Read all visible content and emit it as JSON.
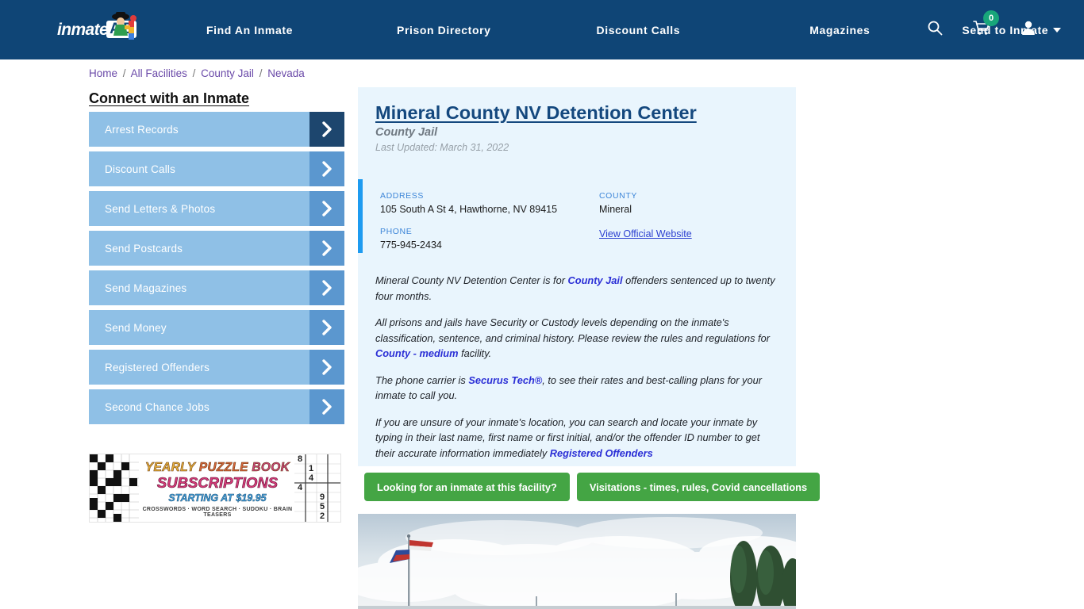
{
  "header": {
    "logo": {
      "text": "inmate",
      "badge": "AID",
      "icon": "inmateaid-logo-icon"
    },
    "nav": [
      {
        "label": "Find An Inmate",
        "has_caret": false
      },
      {
        "label": "Prison Directory",
        "has_caret": false
      },
      {
        "label": "Discount Calls",
        "has_caret": false
      },
      {
        "label": "Magazines",
        "has_caret": false
      },
      {
        "label": "Send to Inmate",
        "has_caret": true
      }
    ],
    "icons": {
      "search": "search-icon",
      "cart": "shopping-cart-icon",
      "cart_count": "0",
      "account": "user-account-icon"
    },
    "background_color": "#0f4576"
  },
  "breadcrumb": {
    "items": [
      "Home",
      "All Facilities",
      "County Jail",
      "Nevada"
    ],
    "separator": "/",
    "link_color": "#6a49a8"
  },
  "sidebar": {
    "title": "Connect with an Inmate",
    "items": [
      {
        "label": "Arrest Records",
        "active": true
      },
      {
        "label": "Discount Calls",
        "active": false
      },
      {
        "label": "Send Letters & Photos",
        "active": false
      },
      {
        "label": "Send Postcards",
        "active": false
      },
      {
        "label": "Send Magazines",
        "active": false
      },
      {
        "label": "Send Money",
        "active": false
      },
      {
        "label": "Registered Offenders",
        "active": false
      },
      {
        "label": "Second Chance Jobs",
        "active": false
      }
    ]
  },
  "ad": {
    "line1_word1": "YEARLY",
    "line1_word2": "PUZZLE",
    "line1_word3": "BOOK",
    "line2": "SUBSCRIPTIONS",
    "line3": "STARTING AT $19.95",
    "line4": "CROSSWORDS · WORD SEARCH · SUDOKU · BRAIN TEASERS",
    "sudoku_digits": [
      "8",
      "1",
      "4",
      "4",
      "9",
      "5",
      "2"
    ]
  },
  "facility": {
    "name": "Mineral County NV Detention Center",
    "type": "County Jail",
    "last_updated": "Last Updated: March 31, 2022",
    "info": {
      "address_label": "ADDRESS",
      "address_value": "105 South A St 4, Hawthorne, NV 89415",
      "phone_label": "PHONE",
      "phone_value": "775-945-2434",
      "county_label": "COUNTY",
      "county_value": "Mineral",
      "website_link": "View Official Website"
    },
    "paragraphs": {
      "p1_a": "Mineral County NV Detention Center is for ",
      "p1_link": "County Jail",
      "p1_b": " offenders sentenced up to twenty four months.",
      "p2_a": "All prisons and jails have Security or Custody levels depending on the inmate's classification, sentence, and criminal history. Please review the rules and regulations for ",
      "p2_link": "County - medium",
      "p2_b": " facility.",
      "p3_a": "The phone carrier is ",
      "p3_link": "Securus Tech®",
      "p3_b": ", to see their rates and best-calling plans for your inmate to call you.",
      "p4_a": "If you are unsure of your inmate's location, you can search and locate your inmate by typing in their last name, first name or first initial, and/or the offender ID number to get their accurate information immediately ",
      "p4_link": "Registered Offenders"
    },
    "buttons": [
      {
        "label": "Looking for an inmate at this facility?"
      },
      {
        "label": "Visitations - times, rules, Covid cancellations"
      }
    ],
    "photo_alt": "facility-exterior-photo"
  },
  "colors": {
    "nav_bg": "#0f4576",
    "panel_bg": "#e9f5fd",
    "accent_bar": "#1e9bf0",
    "title_blue": "#14487e",
    "button_green": "#44a544",
    "sidebar_blue": "#8fc0e6",
    "chevron_blue": "#5b97cf",
    "chevron_active": "#1d466e",
    "badge_green": "#18a67a"
  }
}
